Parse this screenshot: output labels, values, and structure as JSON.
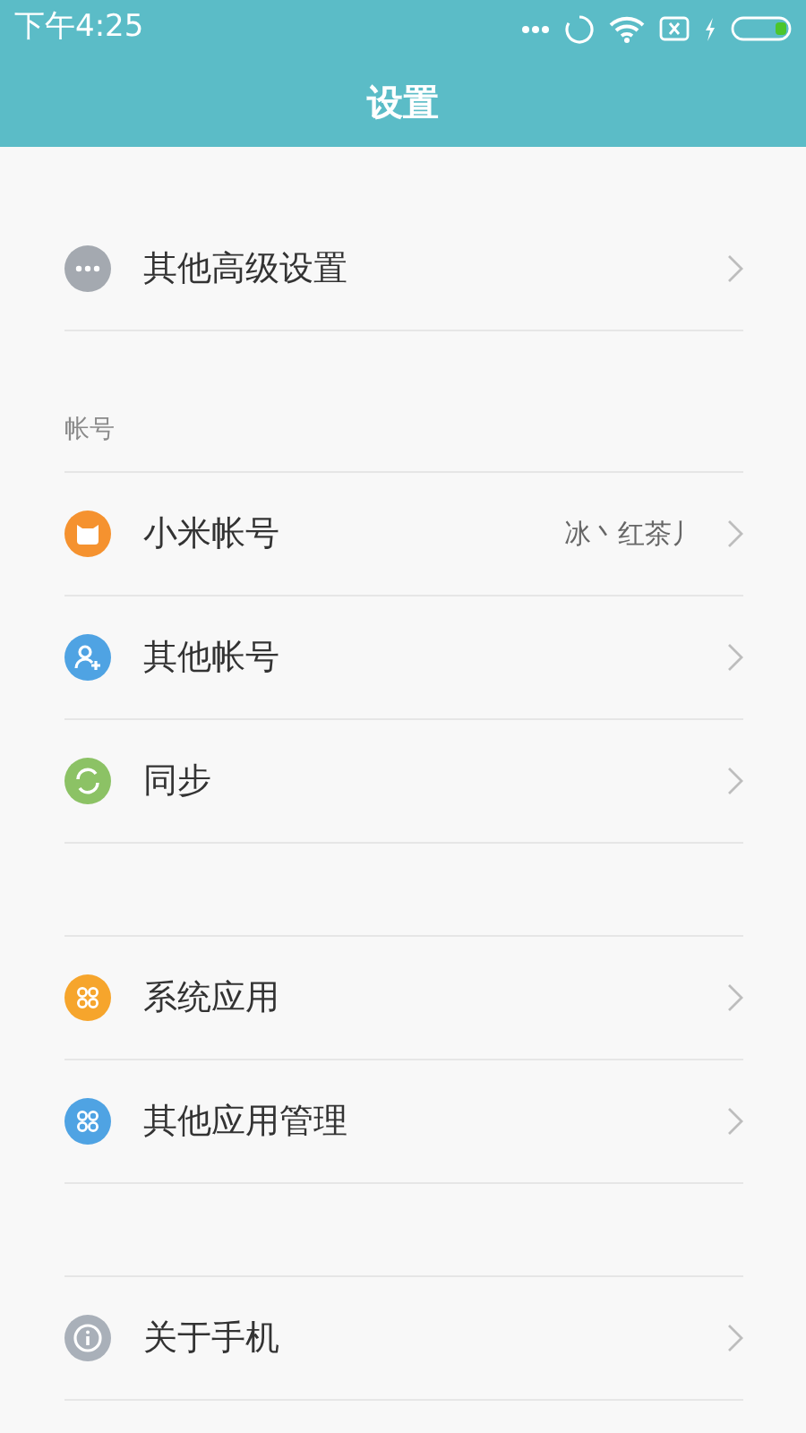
{
  "status_bar": {
    "time": "下午4:25"
  },
  "header": {
    "title": "设置"
  },
  "sections": [
    {
      "items": [
        {
          "label": "其他高级设置",
          "kind": "more",
          "color": "#a4a9b0"
        }
      ]
    },
    {
      "title": "帐号",
      "items": [
        {
          "label": "小米帐号",
          "value": "冰丶红茶丿",
          "kind": "mi",
          "color": "#f5922f"
        },
        {
          "label": "其他帐号",
          "kind": "account",
          "color": "#4fa3e3"
        },
        {
          "label": "同步",
          "kind": "sync",
          "color": "#8cc265"
        }
      ]
    },
    {
      "items": [
        {
          "label": "系统应用",
          "kind": "apps",
          "color": "#f6a52c"
        },
        {
          "label": "其他应用管理",
          "kind": "apps",
          "color": "#4fa3e3"
        }
      ]
    },
    {
      "items": [
        {
          "label": "关于手机",
          "kind": "info",
          "color": "#a9b0b9"
        }
      ]
    }
  ]
}
